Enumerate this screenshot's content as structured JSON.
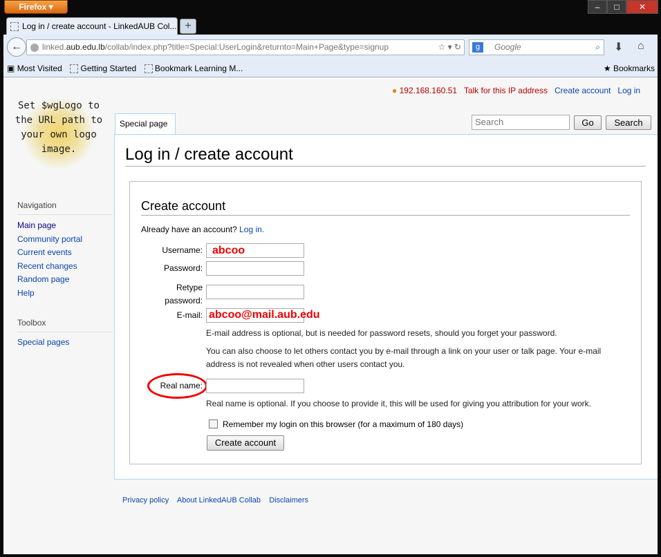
{
  "browser": {
    "menu_label": "Firefox",
    "tab_title": "Log in / create account - LinkedAUB Col...",
    "url_host_pre": "linked.",
    "url_host": "aub.edu.lb",
    "url_path": "/collab/index.php?title=Special:UserLogin&returnto=Main+Page&type=signup",
    "search_placeholder": "Google",
    "bookmarks": [
      "Most Visited",
      "Getting Started",
      "Bookmark Learning M..."
    ],
    "bookmarks_menu": "Bookmarks"
  },
  "personal": {
    "ip": "192.168.160.51",
    "talk": "Talk for this IP address",
    "create": "Create account",
    "login": "Log in"
  },
  "logo_text": "Set $wgLogo to the URL path to your own logo image.",
  "tabs": {
    "special": "Special page"
  },
  "wiki_search": {
    "placeholder": "Search",
    "go": "Go",
    "search": "Search"
  },
  "sidebar": {
    "nav_heading": "Navigation",
    "nav": [
      "Main page",
      "Community portal",
      "Current events",
      "Recent changes",
      "Random page",
      "Help"
    ],
    "toolbox_heading": "Toolbox",
    "toolbox": [
      "Special pages"
    ]
  },
  "main": {
    "title": "Log in / create account",
    "form_title": "Create account",
    "already": "Already have an account?",
    "login_link": "Log in.",
    "labels": {
      "username": "Username:",
      "password": "Password:",
      "retype1": "Retype",
      "retype2": "password:",
      "email": "E-mail:",
      "realname": "Real name:"
    },
    "values": {
      "username": "abcoo",
      "email": "abcoo@mail.aub.edu"
    },
    "email_note1": "E-mail address is optional, but is needed for password resets, should you forget your password.",
    "email_note2": "You can also choose to let others contact you by e-mail through a link on your user or talk page. Your e-mail address is not revealed when other users contact you.",
    "realname_note": "Real name is optional. If you choose to provide it, this will be used for giving you attribution for your work.",
    "remember": "Remember my login on this browser (for a maximum of 180 days)",
    "submit": "Create account"
  },
  "footer": [
    "Privacy policy",
    "About LinkedAUB Collab",
    "Disclaimers"
  ]
}
